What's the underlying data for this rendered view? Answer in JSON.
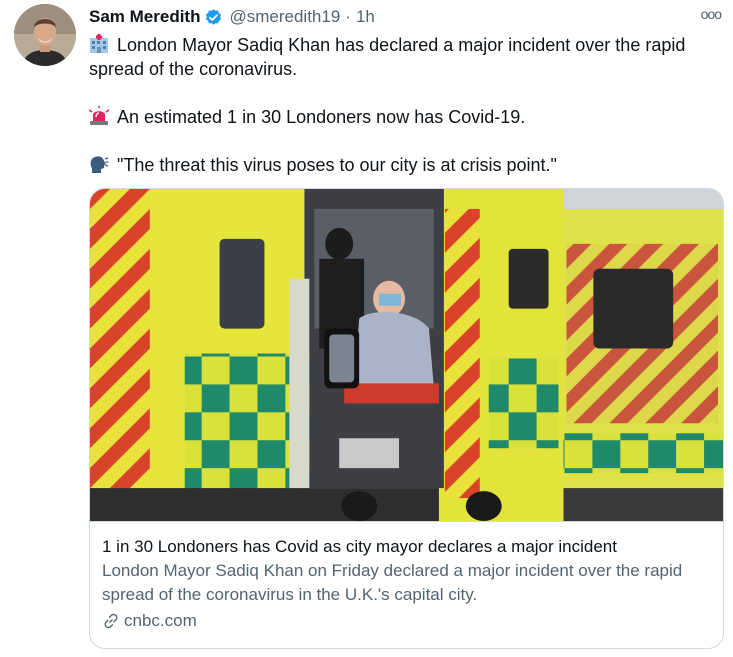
{
  "author": {
    "name": "Sam Meredith",
    "handle": "@smeredith19",
    "separator": "·",
    "time": "1h"
  },
  "more_label": "ooo",
  "paragraphs": [
    {
      "emoji": "hospital-emoji",
      "text": "London Mayor Sadiq Khan has declared a major incident over the rapid spread of the coronavirus."
    },
    {
      "emoji": "rotating-light-emoji",
      "text": "An estimated 1 in 30 Londoners now has Covid-19."
    },
    {
      "emoji": "speaking-head-emoji",
      "text": "\"The threat this virus poses to our city is at crisis point.\""
    }
  ],
  "card": {
    "image_icon": "ambulance-photo",
    "title": "1 in 30 Londoners has Covid as city mayor declares a major incident",
    "description": "London Mayor Sadiq Khan on Friday declared a major incident over the rapid spread of the coronavirus in the U.K.'s capital city.",
    "domain": "cnbc.com"
  },
  "colors": {
    "verified": "#1d9bf0",
    "secondary_text": "#536471",
    "border": "#cfd9de"
  }
}
